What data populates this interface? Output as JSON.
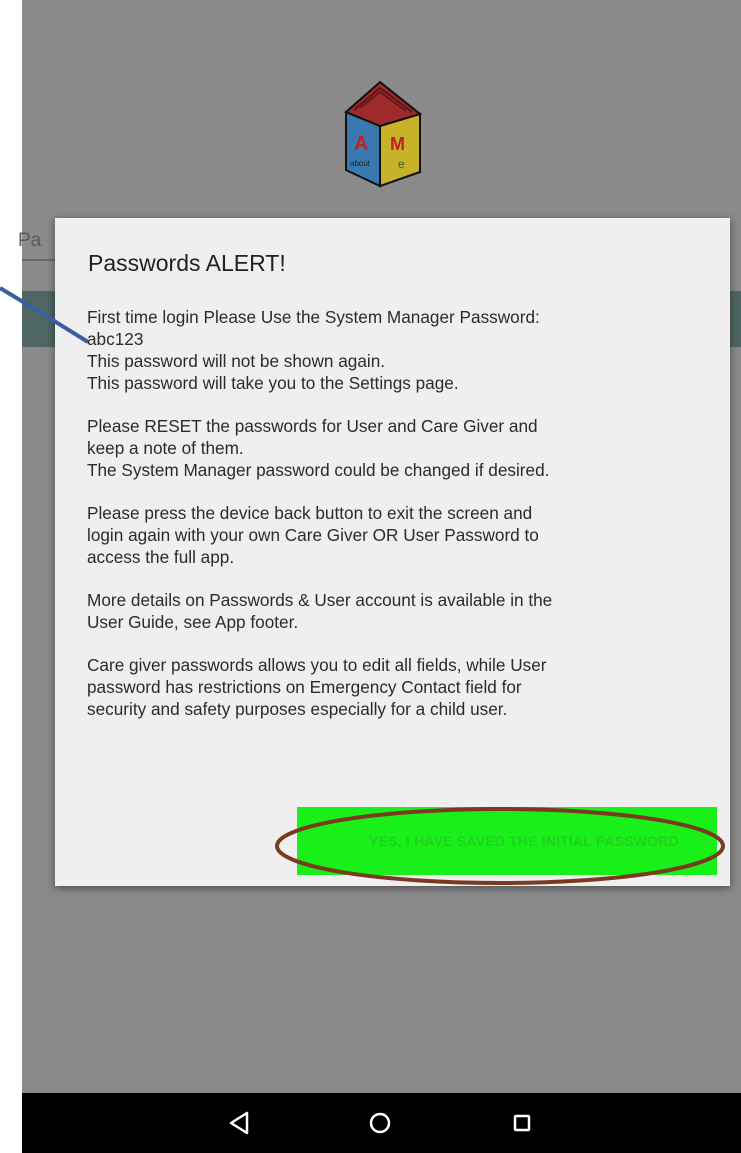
{
  "dialog": {
    "title": "Passwords ALERT!",
    "paragraphs": [
      "First time login Please Use the System Manager Password:\nabc123\nThis password will not be shown again.\nThis password will take you to the Settings page.",
      "Please RESET the passwords for User and Care Giver and\nkeep a note of them.\nThe System Manager password could be changed if desired.",
      "Please press the device back button to exit the screen and\nlogin again with your  own Care Giver OR User Password to\naccess the full app.",
      "More details on Passwords & User account is available in the\nUser Guide, see App footer.",
      "Care giver passwords allows you to edit all fields,  while User\npassword has restrictions on Emergency Contact field for\nsecurity and safety purposes especially for a child user."
    ],
    "confirm_label": "YES, I HAVE SAVED THE INITIAL PASSWORD"
  },
  "background": {
    "password_field_peek": "Pa"
  },
  "navbar": {
    "back_icon": "triangle-back-icon",
    "home_icon": "circle-home-icon",
    "recents_icon": "square-recents-icon"
  },
  "colors": {
    "dim_overlay": "#8a8a8a",
    "dialog_bg": "#efefef",
    "confirm_bg": "#19f019",
    "annotation_ring": "#7a3a1e",
    "annotation_line": "#3a5fa0"
  }
}
